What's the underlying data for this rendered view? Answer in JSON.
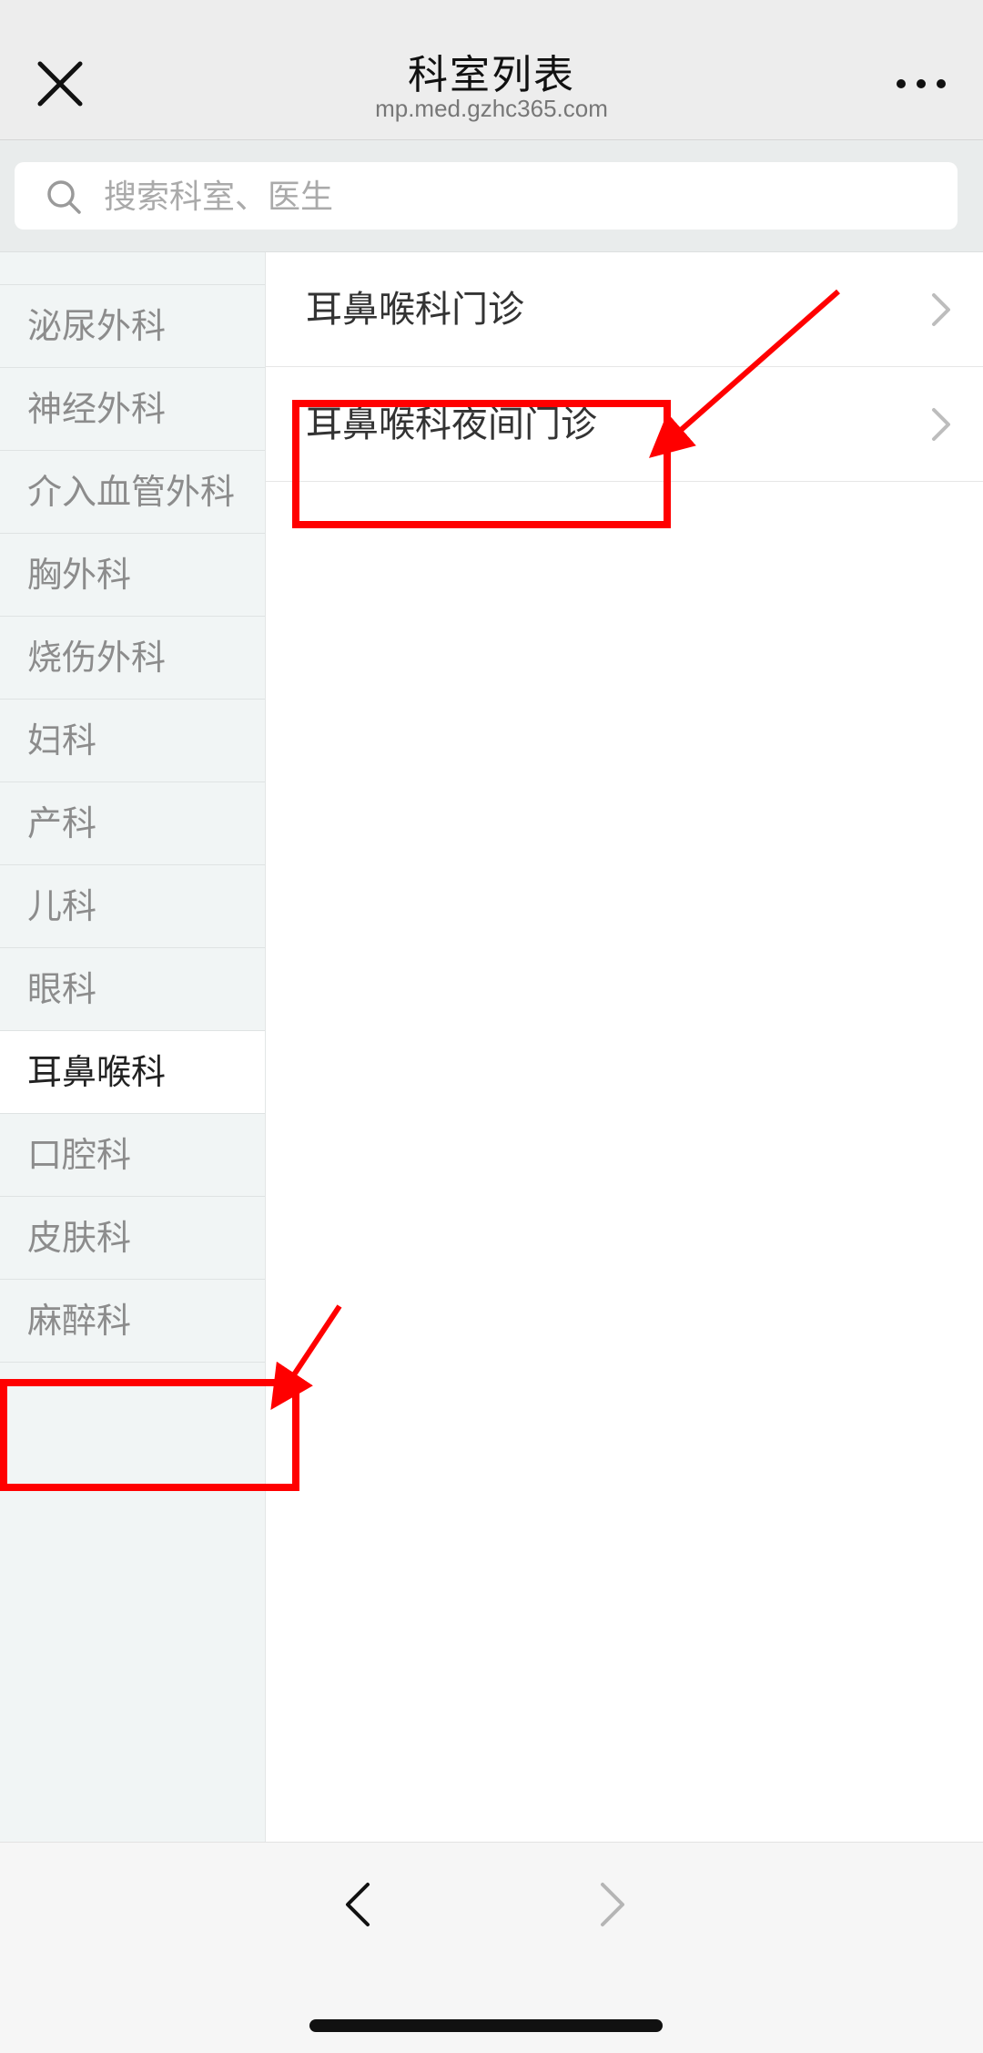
{
  "header": {
    "title": "科室列表",
    "subtitle": "mp.med.gzhc365.com",
    "close_icon": "close-icon",
    "more_icon": "more-horizontal-icon"
  },
  "search": {
    "placeholder": "搜索科室、医生",
    "icon": "search-icon"
  },
  "sidebar": {
    "items": [
      {
        "label": "泌尿外科"
      },
      {
        "label": "神经外科"
      },
      {
        "label": "介入血管外科"
      },
      {
        "label": "胸外科"
      },
      {
        "label": "烧伤外科"
      },
      {
        "label": "妇科"
      },
      {
        "label": "产科"
      },
      {
        "label": "儿科"
      },
      {
        "label": "眼科"
      },
      {
        "label": "耳鼻喉科",
        "active": true
      },
      {
        "label": "口腔科"
      },
      {
        "label": "皮肤科"
      },
      {
        "label": "麻醉科"
      }
    ]
  },
  "sub_departments": [
    {
      "label": "耳鼻喉科门诊"
    },
    {
      "label": "耳鼻喉科夜间门诊"
    }
  ],
  "bottom_bar": {
    "back_icon": "chevron-left-icon",
    "forward_icon": "chevron-right-icon"
  },
  "colors": {
    "annotation": "#ff0000",
    "sidebar_bg": "#f1f5f5",
    "header_bg": "#ededed"
  }
}
